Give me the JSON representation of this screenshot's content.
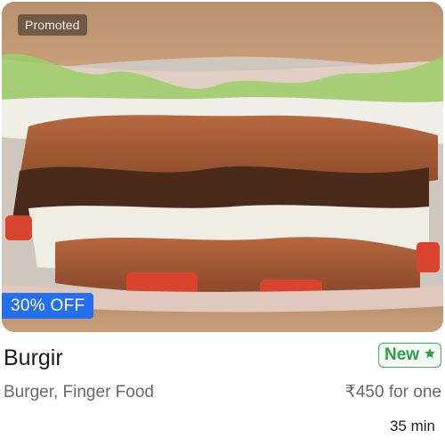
{
  "card": {
    "promoted_label": "Promoted",
    "offer_label": "30% OFF",
    "restaurant_name": "Burgir",
    "badge": {
      "label": "New",
      "icon": "star-icon",
      "color": "#3ab757"
    },
    "cuisines": "Burger, Finger Food",
    "price": "₹450 for one",
    "delivery_time": "35 min",
    "image_icon": "burger-photo",
    "colors": {
      "offer_bg": "#256fef",
      "text_primary": "#1c1c1c",
      "text_secondary": "#696969"
    }
  }
}
